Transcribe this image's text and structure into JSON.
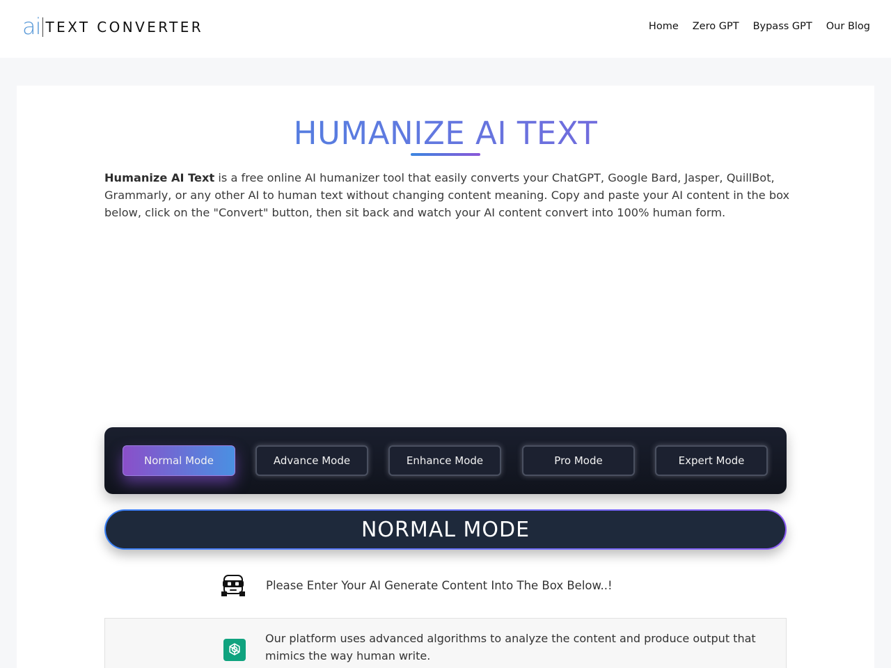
{
  "header": {
    "logo_ai": "ai",
    "logo_text": "TEXT CONVERTER",
    "nav": [
      "Home",
      "Zero GPT",
      "Bypass GPT",
      "Our Blog"
    ]
  },
  "main": {
    "title": "HUMANIZE AI TEXT",
    "intro_bold": "Humanize AI Text",
    "intro_rest": " is a free online AI humanizer tool that easily converts your ChatGPT, Google Bard, Jasper, QuillBot, Grammarly, or any other AI to human text without changing content meaning. Copy and paste your AI content in the box below, click on the \"Convert\" button, then sit back and watch your AI content convert into 100% human form."
  },
  "modes": {
    "buttons": [
      "Normal Mode",
      "Advance Mode",
      "Enhance Mode",
      "Pro Mode",
      "Expert Mode"
    ],
    "active_index": 0,
    "banner": "NORMAL MODE"
  },
  "prompt": {
    "icon": "robot-icon",
    "text": "Please Enter Your AI Generate Content Into The Box Below..!"
  },
  "info": {
    "icon": "chatgpt-icon",
    "text": "Our platform uses advanced algorithms to analyze the content and produce output that mimics the way human write."
  },
  "colors": {
    "title_gradient_start": "#3b86e0",
    "title_gradient_end": "#8a57d8",
    "panel_bg": "#141925",
    "banner_bg": "#1e293b",
    "active_mode_start": "#8a4fc9",
    "active_mode_end": "#4a90e2"
  }
}
